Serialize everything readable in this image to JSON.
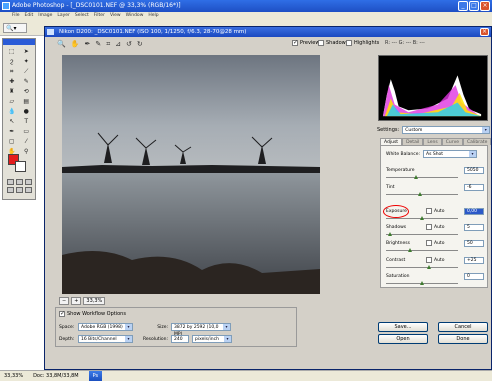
{
  "app": {
    "title": "Adobe Photoshop - [_DSC0101.NEF @ 33,3% (RGB/16*)]",
    "menu": [
      "File",
      "Edit",
      "Image",
      "Layer",
      "Select",
      "Filter",
      "View",
      "Window",
      "Help"
    ],
    "status_zoom": "33,33%",
    "status_doc": "Doc: 33,8M/33,8M"
  },
  "dialog": {
    "title": "Nikon D200: _DSC0101.NEF (ISO 100, 1/1250, f/6.3, 28-70@28 mm)",
    "preview_label": "Preview",
    "shadows_label": "Shadows",
    "highlights_label": "Highlights",
    "rgb_readout": "R: --- G: --- B: ---",
    "zoom_value": "33,3%",
    "preview_checked": true
  },
  "workflow": {
    "show_label": "Show Workflow Options",
    "space_label": "Space:",
    "space_value": "Adobe RGB (1998)",
    "size_label": "Size:",
    "size_value": "3872 by 2592 (10,0 MP)",
    "depth_label": "Depth:",
    "depth_value": "16 Bits/Channel",
    "resolution_label": "Resolution:",
    "resolution_value": "240",
    "resolution_unit": "pixels/inch"
  },
  "settings": {
    "label": "Settings:",
    "value": "Custom",
    "tabs": [
      "Adjust",
      "Detail",
      "Lens",
      "Curve",
      "Calibrate"
    ]
  },
  "adjust": {
    "wb_label": "White Balance:",
    "wb_value": "As Shot",
    "auto_label": "Auto",
    "sliders": [
      {
        "label": "Temperature",
        "value": "5050",
        "pos": 0.42,
        "has_auto": false,
        "highlight": false
      },
      {
        "label": "Tint",
        "value": "-6",
        "pos": 0.47,
        "has_auto": false,
        "highlight": false
      },
      {
        "label": "Exposure",
        "value": "0,00",
        "pos": 0.5,
        "has_auto": true,
        "highlight": true
      },
      {
        "label": "Shadows",
        "value": "5",
        "pos": 0.05,
        "has_auto": true,
        "highlight": false
      },
      {
        "label": "Brightness",
        "value": "50",
        "pos": 0.33,
        "has_auto": true,
        "highlight": false
      },
      {
        "label": "Contrast",
        "value": "+25",
        "pos": 0.6,
        "has_auto": true,
        "highlight": false
      },
      {
        "label": "Saturation",
        "value": "0",
        "pos": 0.5,
        "has_auto": false,
        "highlight": false
      }
    ]
  },
  "buttons": {
    "save": "Save...",
    "cancel": "Cancel",
    "open": "Open",
    "done": "Done"
  },
  "colors": {
    "xp_blue": "#1e4fc4",
    "dialog_bg": "#d4d0c8",
    "foreground_swatch": "#e31d1d",
    "annotation_circle": "#ee0000"
  }
}
